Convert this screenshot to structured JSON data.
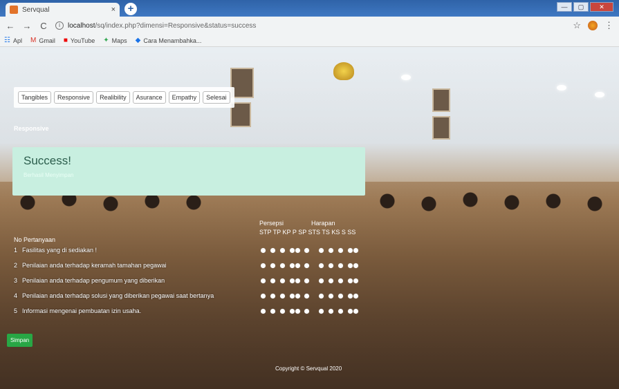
{
  "browser": {
    "tab_title": "Servqual",
    "tab_close": "×",
    "new_tab": "+",
    "url_host": "localhost",
    "url_path": "/sq/index.php?dimensi=Responsive&status=success",
    "bookmarks": [
      {
        "icon": "apps-icon",
        "glyph": "☷",
        "label": "Apl",
        "color": "#1a73e8"
      },
      {
        "icon": "gmail-icon",
        "glyph": "M",
        "label": "Gmail",
        "color": "#d93025"
      },
      {
        "icon": "youtube-icon",
        "glyph": "■",
        "label": "YouTube",
        "color": "#e00"
      },
      {
        "icon": "maps-icon",
        "glyph": "✦",
        "label": "Maps",
        "color": "#34a853"
      },
      {
        "icon": "diamond-icon",
        "glyph": "◆",
        "label": "Cara Menambahka...",
        "color": "#1a73e8"
      }
    ]
  },
  "nav": {
    "tabs": [
      "Tangibles",
      "Responsive",
      "Realibility",
      "Asurance",
      "Empathy",
      "Selesai"
    ]
  },
  "section": "Responsive",
  "alert": {
    "title": "Success!",
    "message": "Berhasil Menyimpan"
  },
  "table": {
    "head_no": "No Pertanyaan",
    "group_persepsi": "Persepsi",
    "group_harapan": "Harapan",
    "scale_labels": "STP TP KP P SP STS TS KS S  SS",
    "questions": [
      {
        "no": "1",
        "text": "Fasilitas yang di sediakan !"
      },
      {
        "no": "2",
        "text": "Penilaian anda terhadap keramah tamahan pegawai"
      },
      {
        "no": "3",
        "text": "Penilaian anda terhadap pengumum yang diberikan"
      },
      {
        "no": "4",
        "text": "Penilaian anda terhadap solusi yang diberikan pegawai saat bertanya"
      },
      {
        "no": "5",
        "text": "Informasi mengenai pembuatan izin usaha."
      }
    ]
  },
  "save_label": "Simpan",
  "footer": "Copyright © Servqual 2020",
  "colors": {
    "alert_bg": "#c8efe0",
    "save_bg": "#28a745"
  }
}
